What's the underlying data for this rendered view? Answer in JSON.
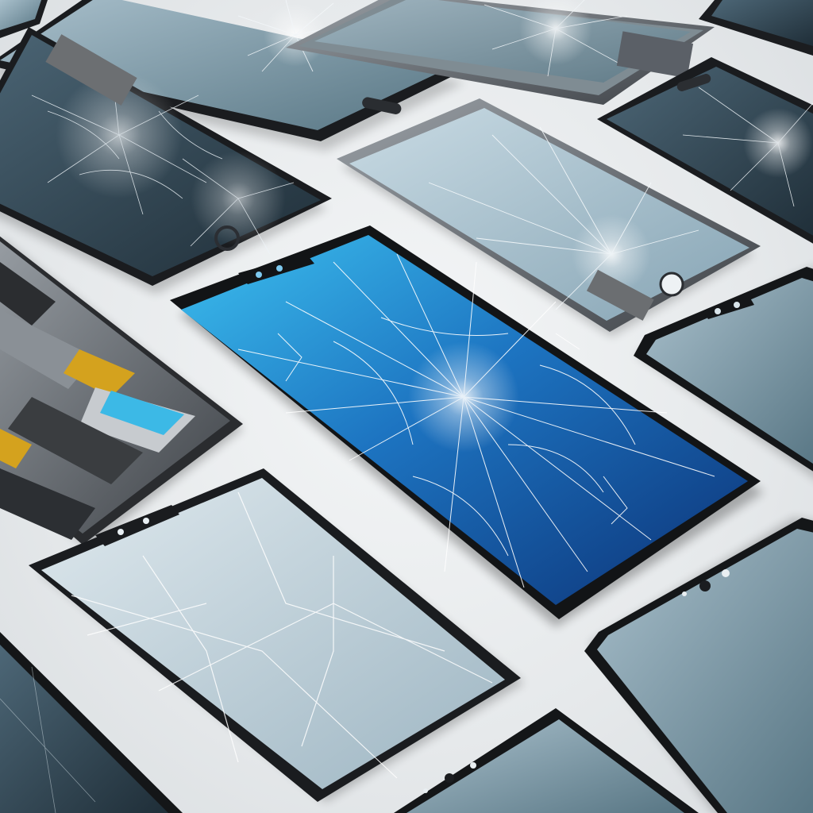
{
  "image": {
    "kind": "photo-illustration",
    "colors": {
      "background": "#e9ecee",
      "bezel": "#1a1c1f",
      "frame_metal": "#6b7076",
      "crack": "#f2f7fb",
      "hero_glass_top": "#35b6ea",
      "hero_glass_bottom": "#0f3f86",
      "tint_glass": "#9fb8c6",
      "dark_glass": "#2e4250",
      "internal_gold": "#d4a21e",
      "internal_blue_tag": "#3cb9e6"
    },
    "phones": [
      {
        "id": "top-center",
        "state": "impact-crack"
      },
      {
        "id": "top-right-frame",
        "state": "shattered-frame"
      },
      {
        "id": "left-shattered",
        "state": "shattered"
      },
      {
        "id": "center-clear-cracked",
        "state": "impact-crack"
      },
      {
        "id": "right-dark-cracked",
        "state": "impact-crack"
      },
      {
        "id": "hero-blue",
        "state": "impact-crack"
      },
      {
        "id": "left-internals",
        "state": "open-chassis"
      },
      {
        "id": "right-plain",
        "state": "intact"
      },
      {
        "id": "bottom-left-lines",
        "state": "line-cracks"
      },
      {
        "id": "bottom-right-plain",
        "state": "intact"
      },
      {
        "id": "bottom-center",
        "state": "intact"
      },
      {
        "id": "bottom-edge-left",
        "state": "intact"
      }
    ]
  }
}
